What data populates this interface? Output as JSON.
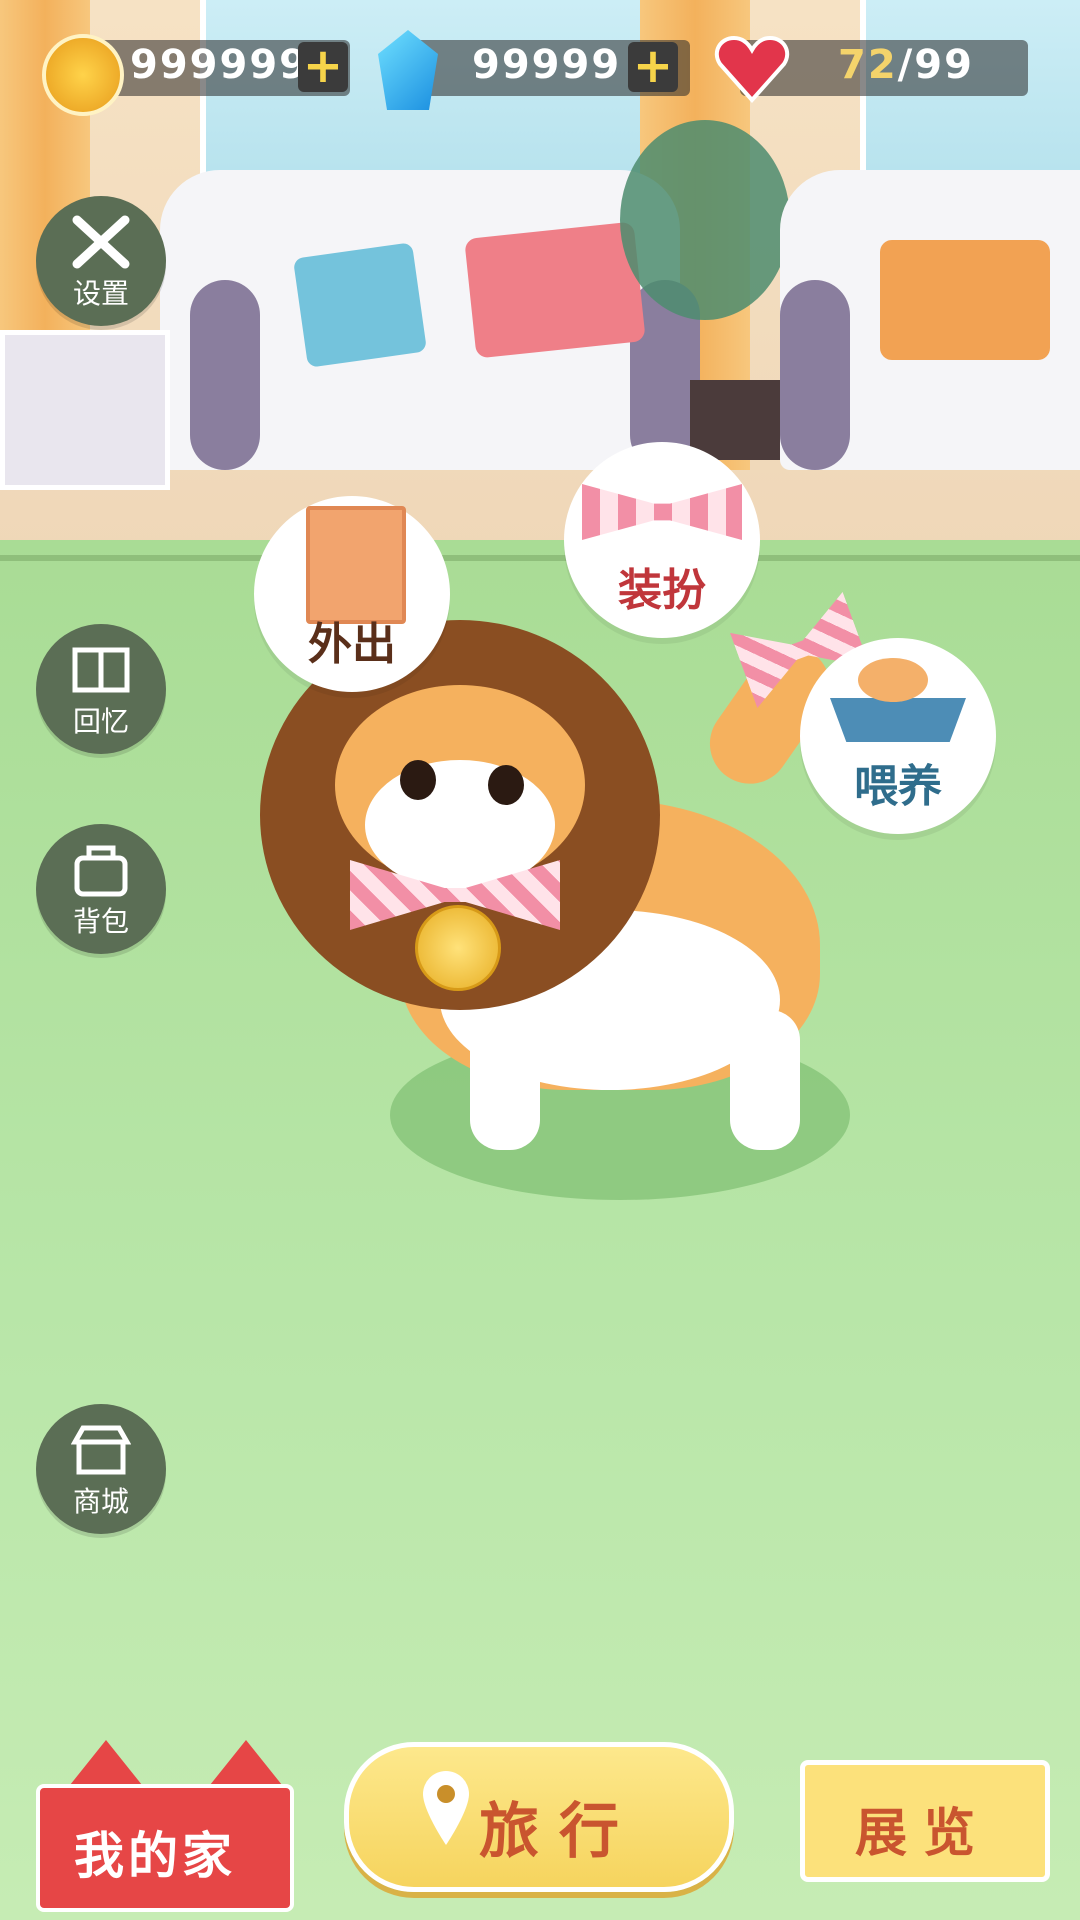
{
  "hud": {
    "coins": "999999",
    "gems": "99999",
    "hearts_current": "72",
    "hearts_max": "/99"
  },
  "side_menu": {
    "settings": "设置",
    "memories": "回忆",
    "backpack": "背包",
    "shop": "商城"
  },
  "actions": {
    "go_out": "外出",
    "dress_up": "装扮",
    "feed": "喂养"
  },
  "bottom_nav": {
    "home": "我的家",
    "travel": "旅行",
    "exhibition": "展览"
  },
  "colors": {
    "home_red": "#e64646",
    "travel_yellow": "#f6d45e",
    "hearts_accent": "#f4d36b",
    "go_out_text": "#5a2f1a",
    "dress_text": "#c0363b",
    "feed_text": "#2f6d8c"
  }
}
